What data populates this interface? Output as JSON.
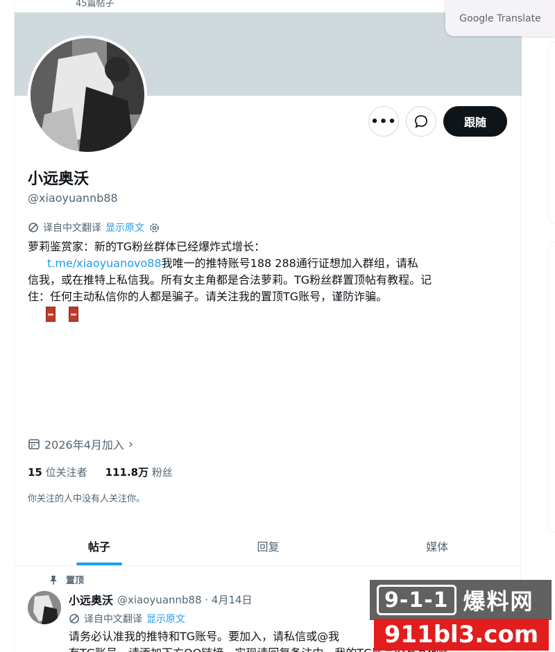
{
  "top": {
    "posts_count": "45篇帖子"
  },
  "google_translate": {
    "label": "Google Translate"
  },
  "profile": {
    "name": "小远奥沃",
    "handle": "@xiaoyuannb88",
    "follow_label": "跟随",
    "translate_label": "译自中文翻译",
    "show_original": "显示原文",
    "bio_line1": "萝莉鉴赏家：新的TG粉丝群体已经爆炸式增长：",
    "bio_link": "t.me/xiaoyuanovo88",
    "bio_rest1": "我唯一的推特账号188 288通行证想加入群组，请私",
    "bio_line3": "信我，或在推特上私信我。所有女主角都是合法萝莉。TG粉丝群置顶帖有教程。记",
    "bio_line4": "住：任何主动私信你的人都是骗子。请关注我的置顶TG账号，谨防诈骗。",
    "joined": "2026年4月加入",
    "following_count": "15",
    "following_label": "位关注者",
    "followers_count": "111.8万",
    "followers_label": "粉丝",
    "no_mutual": "你关注的人中没有人关注你。"
  },
  "tabs": [
    {
      "label": "帖子",
      "active": true
    },
    {
      "label": "回复",
      "active": false
    },
    {
      "label": "媒体",
      "active": false
    }
  ],
  "post": {
    "pinned_label": "置顶",
    "name": "小远奥沃",
    "handle_date": "@xiaoyuannb88 · 4月14日",
    "translate_label": "译自中文翻译",
    "show_original": "显示原文",
    "text_line1": "请务必认准我的推特和TG账号。要加入，请私信或@我",
    "text_line2": "有TG账号，请添加下方QQ链接，实现请回复备注中。我的TG账号没有其他帐"
  },
  "watermark": {
    "logo": "9-1-1",
    "cn": "爆料网",
    "domain": "911bl3.com"
  }
}
